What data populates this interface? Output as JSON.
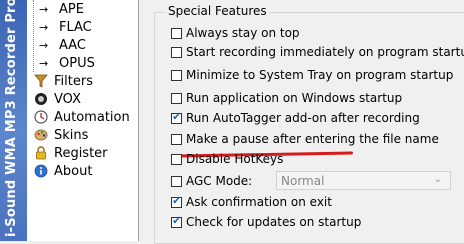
{
  "banner": {
    "text": "i-Sound WMA MP3 Recorder Pro"
  },
  "tree": {
    "subitems": [
      {
        "label": "APE"
      },
      {
        "label": "FLAC"
      },
      {
        "label": "AAC"
      },
      {
        "label": "OPUS"
      }
    ],
    "items": [
      {
        "label": "Filters",
        "icon": "filter-icon"
      },
      {
        "label": "VOX",
        "icon": "microphone-icon"
      },
      {
        "label": "Automation",
        "icon": "clock-icon"
      },
      {
        "label": "Skins",
        "icon": "palette-icon"
      },
      {
        "label": "Register",
        "icon": "lock-icon"
      },
      {
        "label": "About",
        "icon": "info-icon"
      }
    ]
  },
  "special_features": {
    "title": "Special Features",
    "options": [
      {
        "label": "Always stay on top",
        "checked": false
      },
      {
        "label": "Start recording immediately on program startup",
        "checked": false
      },
      {
        "label": "Minimize to System Tray on program startup",
        "checked": false
      },
      {
        "label": "Run application on Windows startup",
        "checked": false
      },
      {
        "label": "Run AutoTagger add-on after recording",
        "checked": true
      },
      {
        "label": "Make a pause after entering the file name",
        "checked": false
      },
      {
        "label": "Disable HotKeys",
        "checked": false
      },
      {
        "label": "AGC Mode:",
        "checked": false
      },
      {
        "label": "Ask confirmation on exit",
        "checked": true
      },
      {
        "label": "Check for updates on startup",
        "checked": true
      }
    ],
    "agc_select": {
      "value": "Normal"
    }
  },
  "colors": {
    "banner": "#4a72bf",
    "highlight_underline": "#d61b1b",
    "check": "#1a5fb4"
  }
}
